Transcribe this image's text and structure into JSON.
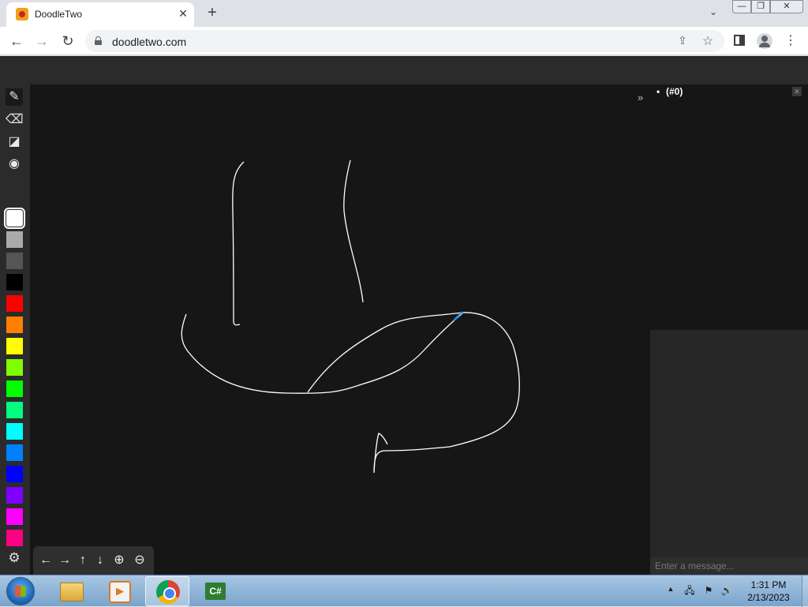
{
  "browser": {
    "tab_title": "DoodleTwo",
    "tab_close": "✕",
    "new_tab": "+",
    "url": "doodletwo.com",
    "back": "←",
    "forward": "→",
    "reload": "↻",
    "share": "⇪",
    "star": "☆",
    "menu": "⋮",
    "tab_search": "⌄",
    "window_min": "—",
    "window_max": "❐",
    "window_close": "✕"
  },
  "tools": {
    "pencil": "✎",
    "eraser": "⌫",
    "fill": "◪",
    "camera": "◉",
    "settings": "⚙"
  },
  "palette": {
    "selected": "#ffffff",
    "colors": [
      "#ffffff",
      "#aaaaaa",
      "#555555",
      "#000000",
      "#ff0000",
      "#ff8000",
      "#ffff00",
      "#80ff00",
      "#00ff00",
      "#00ff80",
      "#00ffff",
      "#0080ff",
      "#0000ff",
      "#8000ff",
      "#ff00ff",
      "#ff0080"
    ]
  },
  "nav": {
    "left": "←",
    "right": "→",
    "up": "↑",
    "down": "↓",
    "zoom_in": "⊕",
    "zoom_out": "⊖"
  },
  "panel": {
    "collapse": "»",
    "close": "✕",
    "users": [
      "(#0)"
    ],
    "chat_placeholder": "Enter a message..."
  },
  "canvas_colors": {
    "background": "#161616",
    "stroke": "#ffffff",
    "cursor_stroke": "#1e90ff"
  },
  "taskbar": {
    "time": "1:31 PM",
    "date": "2/13/2023",
    "tray_up": "▲",
    "tray_network": "🖧",
    "tray_flag": "⚑",
    "tray_volume": "🔊"
  }
}
